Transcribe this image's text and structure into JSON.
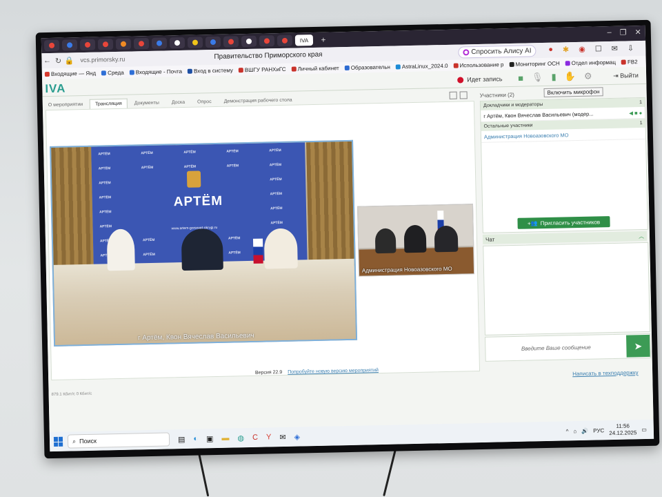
{
  "browser": {
    "page_title": "Правительство Приморского края",
    "url": "vcs.primorsky.ru",
    "alice_label": "Спросить Алису AI",
    "active_tab_label": "IVA"
  },
  "bookmarks": [
    {
      "label": "Входящие — Янд",
      "color": "#d63a2f"
    },
    {
      "label": "Среда",
      "color": "#2f6fd6"
    },
    {
      "label": "Входящие - Почта",
      "color": "#2f6fd6"
    },
    {
      "label": "Вход в систему",
      "color": "#1d4fa3"
    },
    {
      "label": "ВШГУ РАНХиГС",
      "color": "#c9332b"
    },
    {
      "label": "Личный кабинет",
      "color": "#c9332b"
    },
    {
      "label": "Образовательн",
      "color": "#2e6bd1"
    },
    {
      "label": "AstraLinux_2024.0",
      "color": "#1d8bd6"
    },
    {
      "label": "Использование р",
      "color": "#c9332b"
    },
    {
      "label": "Мониторинг ОСН",
      "color": "#222222"
    },
    {
      "label": "Отдел информац",
      "color": "#8b2be0"
    },
    {
      "label": "FB2",
      "color": "#c9332b"
    }
  ],
  "app": {
    "logo": "IVA",
    "record_label": "Идет запись",
    "mic_tooltip": "Включить микрофон",
    "exit_label": "Выйти",
    "tabs": [
      "О мероприятии",
      "Трансляция",
      "Документы",
      "Доска",
      "Опрос",
      "Демонстрация рабочего стола"
    ],
    "active_tab": "Трансляция",
    "main_video_caption": "г Артём, Квон Вячеслав Васильевич",
    "banner_text": "АРТЁМ",
    "banner_site": "www.artem-gorsovet-okrugi.ru",
    "second_video_caption": "Администрация Новоазовского МО",
    "status_text": "879.1 Кбит/с  0 Кбит/с",
    "version_label": "Версия 22.9",
    "version_link": "Попробуйте новую версию мероприятий",
    "support_link": "Написать в техподдержку"
  },
  "participants": {
    "title": "Участники (2)",
    "groups": [
      {
        "label": "Докладчики и модераторы",
        "count": "1",
        "members": [
          "г Артём, Квон Вячеслав Васильевич (модер..."
        ]
      },
      {
        "label": "Остальные участники",
        "count": "1",
        "members": [
          "Администрация Новоазовского МО"
        ]
      }
    ],
    "invite_label": "Пригласить участников"
  },
  "chat": {
    "title": "Чат",
    "placeholder": "Введите Ваше сообщение"
  },
  "taskbar": {
    "search_label": "Поиск",
    "lang": "РУС",
    "time": "11:56",
    "date": "24.12.2025"
  },
  "colors": {
    "accent": "#3c9b55",
    "link": "#3b7fb0",
    "record": "#d0102a"
  }
}
